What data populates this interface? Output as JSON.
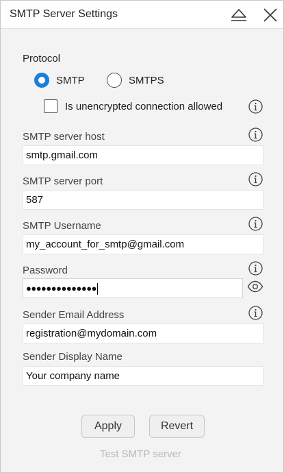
{
  "window": {
    "title": "SMTP Server Settings"
  },
  "protocol": {
    "label": "Protocol",
    "options": [
      {
        "label": "SMTP",
        "selected": true
      },
      {
        "label": "SMTPS",
        "selected": false
      }
    ],
    "unencrypted_label": "Is unencrypted connection allowed",
    "unencrypted_checked": false
  },
  "fields": {
    "host": {
      "label": "SMTP server host",
      "value": "smtp.gmail.com"
    },
    "port": {
      "label": "SMTP server port",
      "value": "587"
    },
    "username": {
      "label": "SMTP Username",
      "value": "my_account_for_smtp@gmail.com"
    },
    "password": {
      "label": "Password",
      "value": "●●●●●●●●●●●●●●"
    },
    "sender_email": {
      "label": "Sender Email Address",
      "value": "registration@mydomain.com"
    },
    "sender_name": {
      "label": "Sender Display Name",
      "value": "Your company name"
    }
  },
  "actions": {
    "apply_label": "Apply",
    "revert_label": "Revert",
    "test_label": "Test SMTP server"
  },
  "colors": {
    "accent": "#1a7fd8",
    "background": "#f3f3f3",
    "disabled_text": "#b9b9b9"
  }
}
